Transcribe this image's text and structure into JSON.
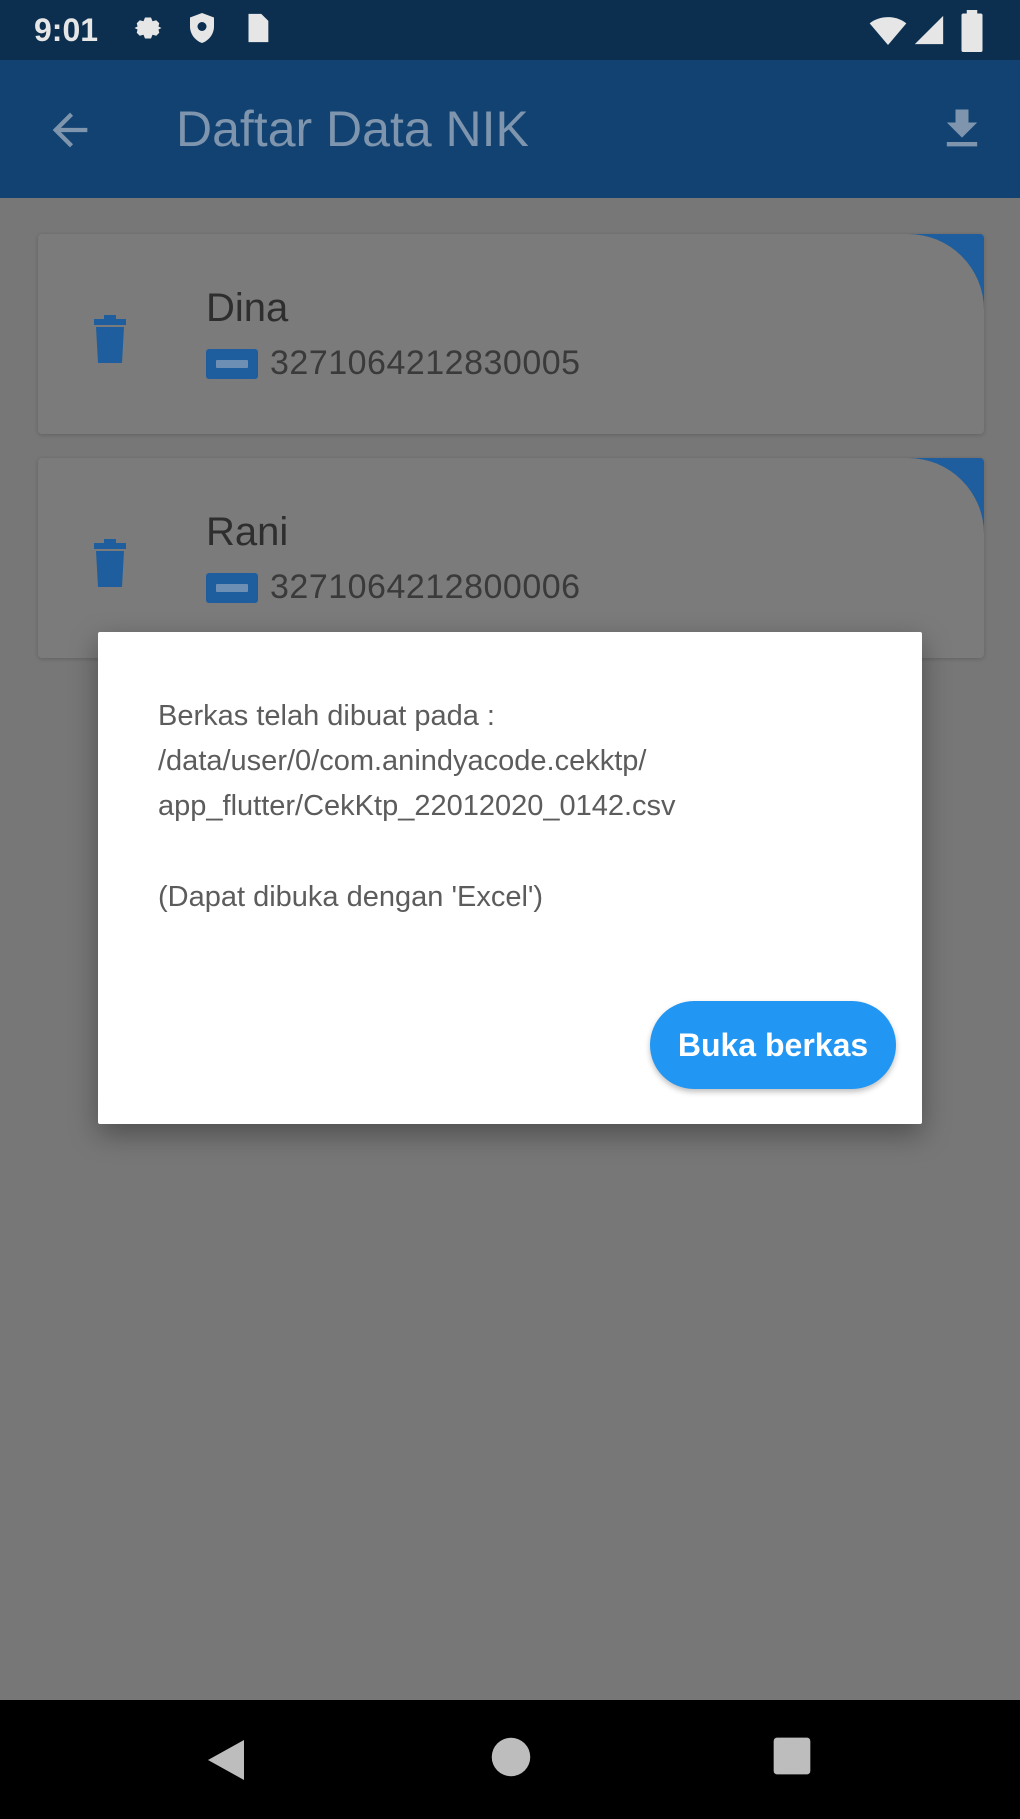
{
  "status_bar": {
    "time": "9:01",
    "left_icons": [
      "gear-icon",
      "shield-icon",
      "sim-card-icon"
    ],
    "right_icons": [
      "wifi-icon",
      "signal-icon",
      "battery-icon"
    ]
  },
  "app_bar": {
    "title": "Daftar Data NIK",
    "back_icon": "arrow-back-icon",
    "action_icon": "download-icon"
  },
  "list": {
    "items": [
      {
        "name": "Dina",
        "nik": "3271064212830005"
      },
      {
        "name": "Rani",
        "nik": "3271064212800006"
      }
    ]
  },
  "dialog": {
    "line1": "Berkas telah dibuat pada :",
    "line2": "/data/user/0/com.anindyacode.cekktp/",
    "line3": "app_flutter/CekKtp_22012020_0142.csv",
    "hint": "(Dapat dibuka dengan 'Excel')",
    "button_label": "Buka berkas"
  },
  "colors": {
    "app_bar": "#124271",
    "status_bar": "#0c2f4f",
    "accent": "#2196f3",
    "card_corner": "#1e5e9e"
  },
  "nav_bar": {
    "icons": [
      "back-triangle-icon",
      "home-circle-icon",
      "recents-square-icon"
    ]
  }
}
